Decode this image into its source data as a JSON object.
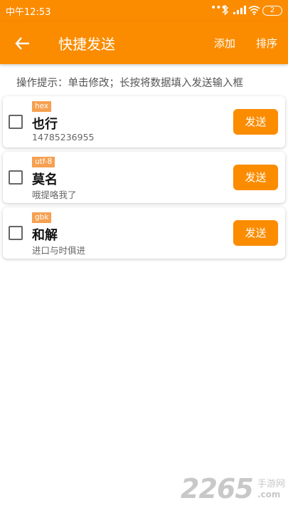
{
  "status_bar": {
    "time": "中午12:53",
    "dots": "•••",
    "battery": "2",
    "icons": [
      "bluetooth-icon",
      "signal-icon",
      "wifi-icon",
      "battery-icon"
    ]
  },
  "app_bar": {
    "title": "快捷发送",
    "add_label": "添加",
    "sort_label": "排序",
    "back_icon": "arrow-left-icon"
  },
  "hint": "操作提示：单击修改；长按将数据填入发送输入框",
  "items": [
    {
      "encoding": "hex",
      "name": "也行",
      "content": "14785236955",
      "send_label": "发送",
      "checked": false
    },
    {
      "encoding": "utf-8",
      "name": "莫名",
      "content": "哦提咯我了",
      "send_label": "发送",
      "checked": false
    },
    {
      "encoding": "gbk",
      "name": "和解",
      "content": "进口与时俱进",
      "send_label": "发送",
      "checked": false
    }
  ],
  "watermark": {
    "number": "2265",
    "site": "手游网",
    "domain": ".com"
  },
  "colors": {
    "accent": "#fb8c00",
    "tag": "#f6a050",
    "background": "#ffffff"
  }
}
